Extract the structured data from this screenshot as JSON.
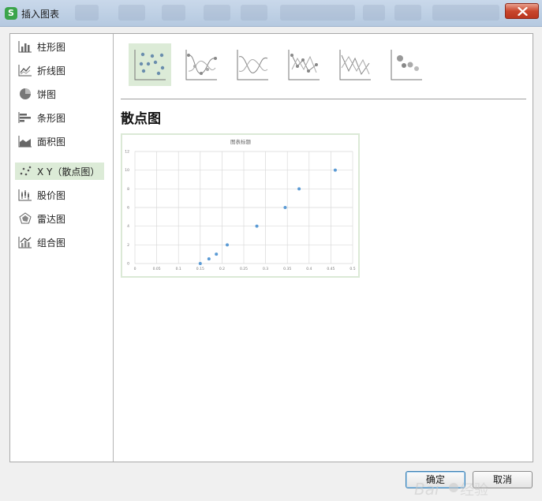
{
  "window": {
    "title": "插入图表",
    "app_logo": "S"
  },
  "sidebar": {
    "items": [
      {
        "label": "柱形图",
        "icon": "column-chart-icon"
      },
      {
        "label": "折线图",
        "icon": "line-chart-icon"
      },
      {
        "label": "饼图",
        "icon": "pie-chart-icon"
      },
      {
        "label": "条形图",
        "icon": "bar-chart-icon"
      },
      {
        "label": "面积图",
        "icon": "area-chart-icon"
      },
      {
        "label": "X Y（散点图）",
        "icon": "scatter-chart-icon",
        "selected": true
      },
      {
        "label": "股价图",
        "icon": "stock-chart-icon"
      },
      {
        "label": "雷达图",
        "icon": "radar-chart-icon"
      },
      {
        "label": "组合图",
        "icon": "combo-chart-icon"
      }
    ]
  },
  "subtypes": [
    {
      "name": "scatter-markers-only",
      "selected": true
    },
    {
      "name": "scatter-smooth-lines-markers"
    },
    {
      "name": "scatter-smooth-lines"
    },
    {
      "name": "scatter-straight-lines-markers"
    },
    {
      "name": "scatter-straight-lines"
    },
    {
      "name": "bubble"
    }
  ],
  "section": {
    "title": "散点图"
  },
  "chart_data": {
    "type": "scatter",
    "title": "图表标题",
    "x_ticks": [
      "0",
      "0.05",
      "0.1",
      "0.15",
      "0.2",
      "0.25",
      "0.3",
      "0.35",
      "0.4",
      "0.45",
      "0.5"
    ],
    "y_ticks": [
      "0",
      "2",
      "4",
      "6",
      "8",
      "10",
      "12"
    ],
    "xlim": [
      0,
      0.5
    ],
    "ylim": [
      0,
      12
    ],
    "grid": true,
    "marker_color": "#5b9bd5",
    "points": [
      {
        "x": 0.15,
        "y": 0
      },
      {
        "x": 0.17,
        "y": 0.5
      },
      {
        "x": 0.187,
        "y": 1
      },
      {
        "x": 0.212,
        "y": 2
      },
      {
        "x": 0.28,
        "y": 4
      },
      {
        "x": 0.345,
        "y": 6
      },
      {
        "x": 0.377,
        "y": 8
      },
      {
        "x": 0.46,
        "y": 10
      }
    ]
  },
  "buttons": {
    "ok": "确定",
    "cancel": "取消"
  }
}
